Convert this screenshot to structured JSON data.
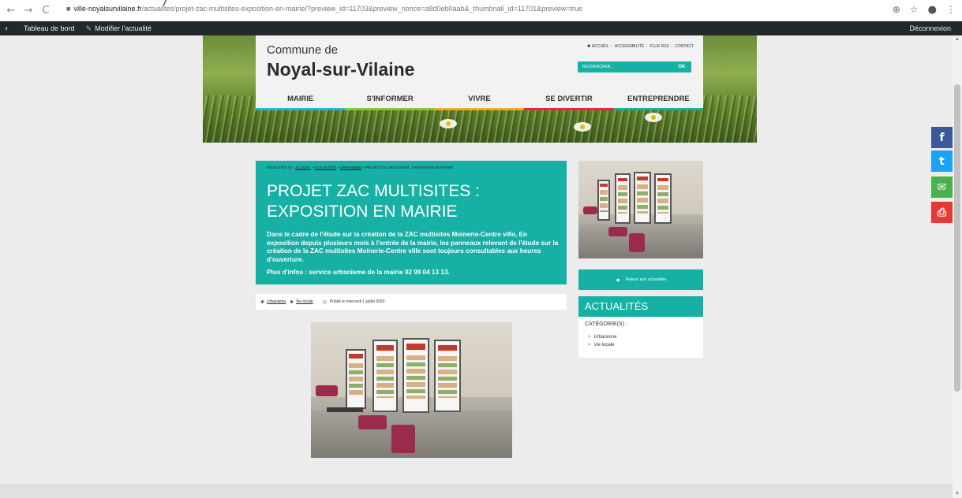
{
  "browser": {
    "back": "←",
    "forward": "→",
    "reload": "C",
    "lock": "🔒",
    "url_host": "ville-noyalsurvilaine.fr",
    "url_path": "/actualites/projet-zac-multisites-exposition-en-mairie/?preview_id=11703&preview_nonce=a8d0eb0aab&_thumbnail_id=11701&preview=true",
    "zoom_icon": "⊕",
    "star_icon": "☆",
    "avatar_icon": "●",
    "menu_icon": "⋮",
    "cut_text": "/"
  },
  "admin_bar": {
    "dashboard": "Tableau de bord",
    "edit": "Modifier l'actualité",
    "logout": "Déconnexion"
  },
  "header": {
    "commune": "Commune de",
    "town": "Noyal-sur-Vilaine",
    "links": [
      "ACCUEIL",
      "ACCESSIBILITÉ",
      "FLUX RSS",
      "CONTACT"
    ],
    "search_placeholder": "RECHERCHER...",
    "search_ok": "OK"
  },
  "nav": {
    "items": [
      {
        "label": "MAIRIE",
        "color": "#22b8e0"
      },
      {
        "label": "S'INFORMER",
        "color": "#8cc63f"
      },
      {
        "label": "VIVRE",
        "color": "#f7a823"
      },
      {
        "label": "SE DIVERTIR",
        "color": "#e5293c"
      },
      {
        "label": "ENTREPRENDRE",
        "color": "#16b0a4"
      }
    ]
  },
  "social": {
    "facebook": "f",
    "twitter": "t",
    "email": "✉",
    "print": "⎙",
    "colors": {
      "facebook": "#3b5998",
      "twitter": "#1da1f2",
      "email": "#4caf50",
      "print": "#e53935"
    }
  },
  "breadcrumb": {
    "prefix": "VOUS ÊTES ICI :",
    "home": "ACCUEIL",
    "section": "ACTUALITÉS",
    "category": "URBANISME",
    "current": "PROJET ZAC MULTISITES : EXPOSITION EN MAIRIE",
    "sep": "»"
  },
  "article": {
    "title": "PROJET ZAC MULTISITES : EXPOSITION EN MAIRIE",
    "text": "Dans le cadre de l'étude sur la création de la ZAC multisites Moinerie-Centre ville, En exposition depuis plusieurs mois à l'entrée de la mairie, les panneaux relevant de l'étude sur la création de la ZAC multisites Moinerie-Centre ville sont toujours consultables aux heures d'ouverture.",
    "more": "Plus d'infos : service urbanisme de la mairie 02 99 04 13 13.",
    "tag1": "Urbanisme",
    "tag2": "Vie locale",
    "published": "Publié le mercredi 1 juillet 2020"
  },
  "sidebar": {
    "back": "Retour aux actualités",
    "actu_title": "ACTUALITÉS",
    "categories_label": "CATÉGORIE(S) :",
    "categories": [
      "Urbanisme",
      "Vie locale"
    ]
  },
  "colors": {
    "accent": "#16b0a4"
  }
}
